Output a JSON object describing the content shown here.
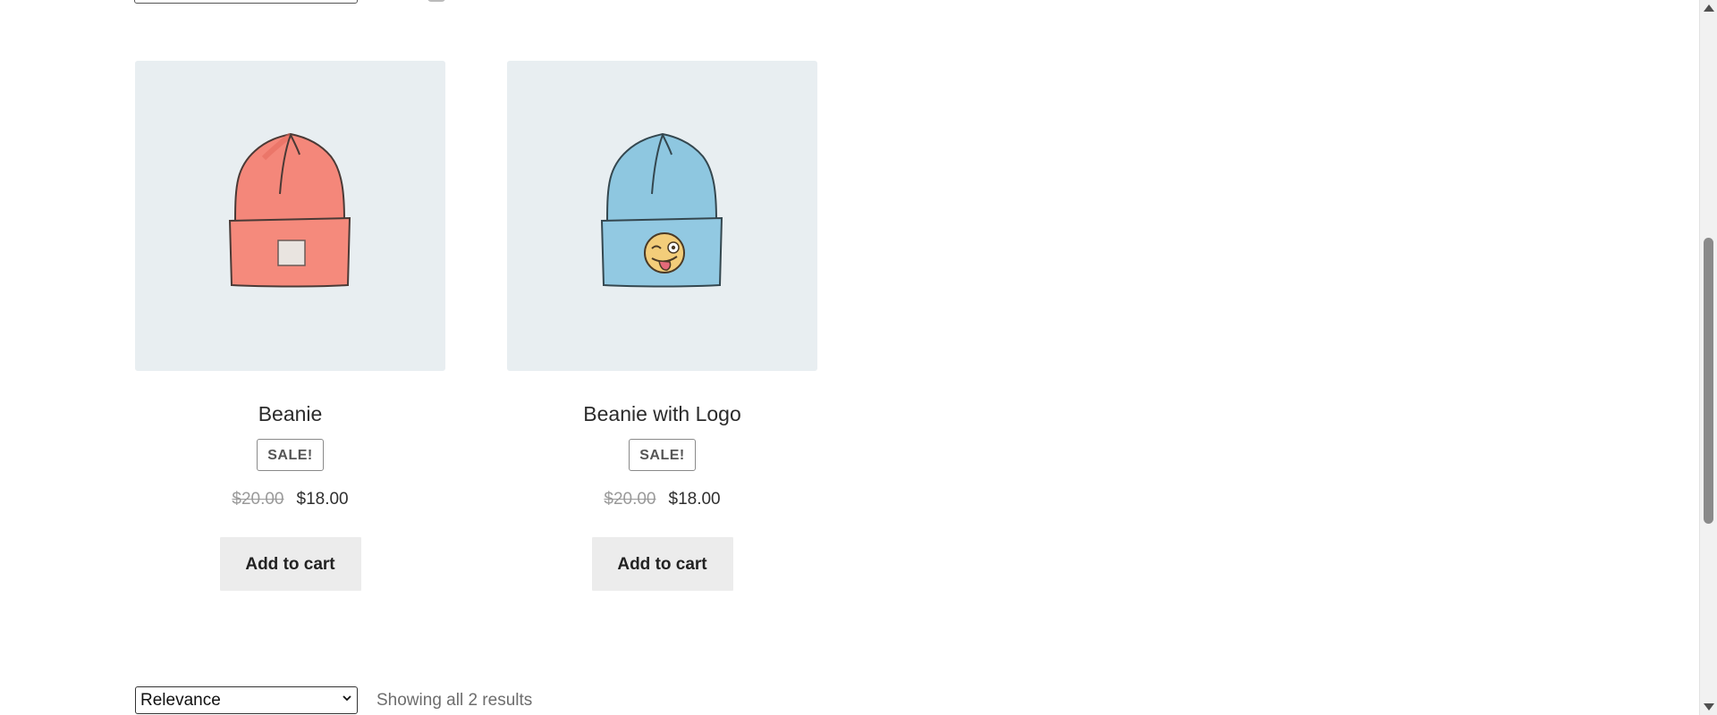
{
  "products": [
    {
      "title": "Beanie",
      "badge": "SALE!",
      "old_price": "$20.00",
      "new_price": "$18.00",
      "button_label": "Add to cart",
      "image_icon": "beanie-icon",
      "image_color": "#f4877a"
    },
    {
      "title": "Beanie with Logo",
      "badge": "SALE!",
      "old_price": "$20.00",
      "new_price": "$18.00",
      "button_label": "Add to cart",
      "image_icon": "beanie-logo-icon",
      "image_color": "#8ec7e0"
    }
  ],
  "sort": {
    "selected": "Relevance"
  },
  "results": {
    "count_text": "Showing all 2 results"
  },
  "colors": {
    "image_bg": "#e8eef1",
    "button_bg": "#ececec"
  }
}
